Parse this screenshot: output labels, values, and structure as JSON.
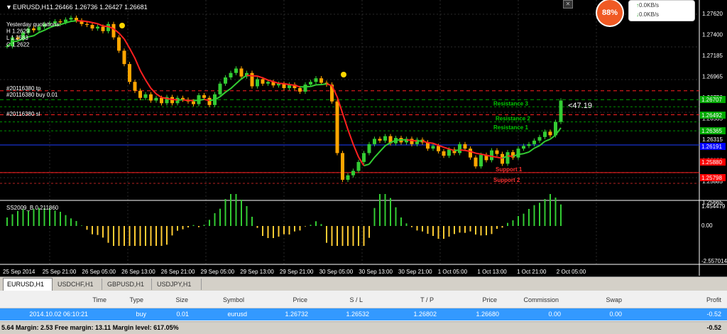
{
  "chart": {
    "title": "EURUSD,H1",
    "ohlc": "1.26466 1.26736 1.26427 1.26681",
    "colors": {
      "bull": "#33cc33",
      "bear": "#ffa500",
      "ma_up": "#33cc33",
      "ma_down": "#ff2020",
      "grid": "#2a2a2a",
      "osc_pos": "#33cc33",
      "osc_neg": "#ffcc33"
    },
    "info_lines": [
      "Yesterday quotations:",
      "H 1.2629",
      "L 1.2583",
      "C 1.2622"
    ],
    "order_labels": [
      "#20116380 tp",
      "#20116380 buy 0.01",
      "#20116380 sl"
    ],
    "price_axis": [
      "1.27620",
      "1.27400",
      "1.27185",
      "1.26965",
      "1.26750",
      "1.26535",
      "1.26315",
      "1.26100",
      "1.25885",
      "1.25665"
    ],
    "price_tags": [
      {
        "text": "1.26707",
        "color": "#00aa00"
      },
      {
        "text": "1.26492",
        "color": "#00aa00"
      },
      {
        "text": "1.26365",
        "color": "#00aa00"
      },
      {
        "text": "1.26191",
        "color": "#0000ff"
      },
      {
        "text": "1.25880",
        "color": "#ff0000"
      },
      {
        "text": "1.25798",
        "color": "#ff0000"
      }
    ],
    "levels": [
      {
        "label": "Resistance 3",
        "price": 1.2662,
        "color": "#00cc00"
      },
      {
        "label": "Resistance 2",
        "price": 1.2645,
        "color": "#00cc00"
      },
      {
        "label": "Resistance 1",
        "price": 1.2635,
        "color": "#00cc00"
      },
      {
        "label": "Support 1",
        "price": 1.2588,
        "color": "#ff3030"
      },
      {
        "label": "Support 2",
        "price": 1.2576,
        "color": "#ff3030"
      }
    ],
    "order_lines": [
      {
        "price": 1.268,
        "color": "#ff2020"
      },
      {
        "price": 1.267,
        "color": "#00aa00"
      },
      {
        "price": 1.2653,
        "color": "#ff2020"
      }
    ],
    "bid_line": 1.26191,
    "ask_line": 1.2588,
    "pips_label": "<47.19",
    "oscillator": {
      "name": "SS2009_B 0.211860",
      "axis": [
        "1.454479",
        "0.00",
        "-2.557014"
      ]
    },
    "time_axis": [
      "25 Sep 2014",
      "25 Sep 21:00",
      "26 Sep 05:00",
      "26 Sep 13:00",
      "26 Sep 21:00",
      "29 Sep 05:00",
      "29 Sep 13:00",
      "29 Sep 21:00",
      "30 Sep 05:00",
      "30 Sep 13:00",
      "30 Sep 21:00",
      "1 Oct 05:00",
      "1 Oct 13:00",
      "1 Oct 21:00",
      "2 Oct 05:00"
    ],
    "closes": [
      1.273,
      1.274,
      1.2738,
      1.2745,
      1.275,
      1.2748,
      1.2752,
      1.2755,
      1.2756,
      1.2758,
      1.2757,
      1.276,
      1.2762,
      1.2759,
      1.2755,
      1.2754,
      1.275,
      1.2752,
      1.2747,
      1.2755,
      1.274,
      1.2725,
      1.271,
      1.269,
      1.268,
      1.2672,
      1.2676,
      1.2669,
      1.2672,
      1.2666,
      1.2673,
      1.2666,
      1.2672,
      1.267,
      1.2668,
      1.2665,
      1.2675,
      1.2672,
      1.2664,
      1.2676,
      1.2688,
      1.2695,
      1.27,
      1.2705,
      1.2696,
      1.27,
      1.2685,
      1.2693,
      1.2688,
      1.269,
      1.2686,
      1.2688,
      1.2683,
      1.2687,
      1.2683,
      1.2679,
      1.2687,
      1.269,
      1.2694,
      1.2689,
      1.2687,
      1.2668,
      1.261,
      1.258,
      1.2585,
      1.259,
      1.26,
      1.261,
      1.262,
      1.2626,
      1.2624,
      1.2629,
      1.2621,
      1.2627,
      1.2622,
      1.2626,
      1.262,
      1.2625,
      1.2622,
      1.2615,
      1.2618,
      1.2612,
      1.2607,
      1.2614,
      1.261,
      1.262,
      1.2615,
      1.2605,
      1.2595,
      1.2608,
      1.2602,
      1.2613,
      1.2609,
      1.2598,
      1.2611,
      1.2605,
      1.2615,
      1.2618,
      1.262,
      1.2624,
      1.2628,
      1.2634,
      1.263,
      1.2645,
      1.2669
    ]
  },
  "tabs": [
    "EURUSD,H1",
    "USDCHF,H1",
    "GBPUSD,H1",
    "USDJPY,H1"
  ],
  "table": {
    "headers": [
      "Time",
      "Type",
      "Size",
      "Symbol",
      "Price",
      "S / L",
      "T / P",
      "Price",
      "Commission",
      "Swap",
      "Profit"
    ],
    "row": [
      "2014.10.02 06:10:21",
      "buy",
      "0.01",
      "eurusd",
      "1.26732",
      "1.26532",
      "1.26802",
      "1.26680",
      "0.00",
      "0.00",
      "-0.52"
    ],
    "summary": "5.64  Margin: 2.53  Free margin: 13.11  Margin level: 617.05%",
    "summary_profit": "-0.52"
  },
  "overlay": {
    "percent": "88%",
    "up": "0.0KB/s",
    "down": "0.0KB/s"
  }
}
